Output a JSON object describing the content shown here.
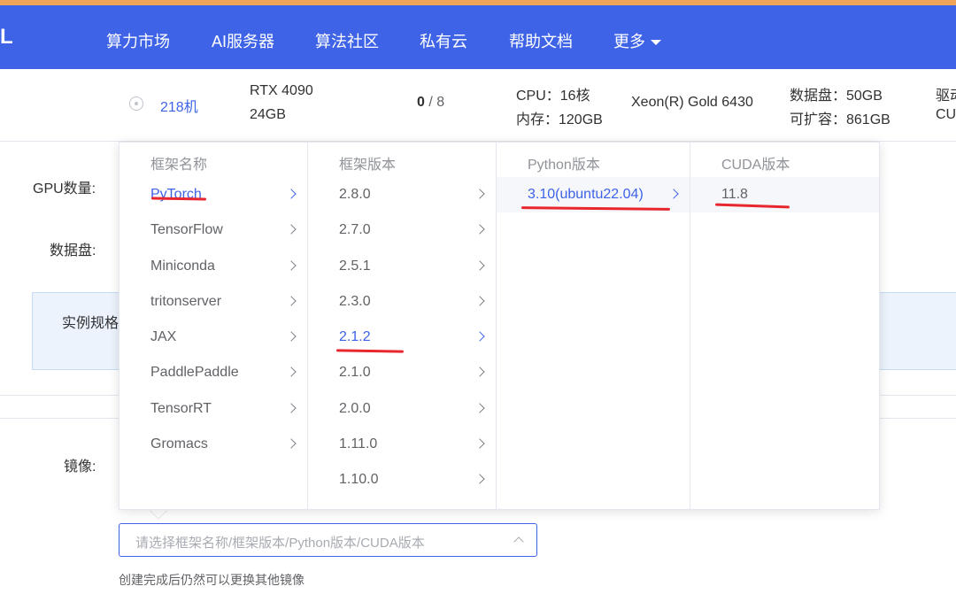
{
  "nav": {
    "logo": "L",
    "items": [
      "算力市场",
      "AI服务器",
      "算法社区",
      "私有云",
      "帮助文档",
      "更多"
    ]
  },
  "machine": {
    "name": "218机",
    "gpu_model": "RTX 4090",
    "gpu_mem": "24GB",
    "gpu_free": "0",
    "gpu_total": "/ 8",
    "cpu": "CPU：16核",
    "mem": "内存：120GB",
    "cpu_model": "Xeon(R) Gold 6430",
    "disk": "数据盘：50GB",
    "disk_expand": "可扩容：861GB",
    "driver_label": "驱动",
    "cuda_label": "CU"
  },
  "form": {
    "gpu_count_label": "GPU数量:",
    "data_disk_label": "数据盘:",
    "spec_label": "实例规格",
    "image_label": "镜像:"
  },
  "cascader": {
    "columns": [
      {
        "header": "框架名称",
        "options": [
          "PyTorch",
          "TensorFlow",
          "Miniconda",
          "tritonserver",
          "JAX",
          "PaddlePaddle",
          "TensorRT",
          "Gromacs"
        ],
        "active": 0
      },
      {
        "header": "框架版本",
        "options": [
          "2.8.0",
          "2.7.0",
          "2.5.1",
          "2.3.0",
          "2.1.2",
          "2.1.0",
          "2.0.0",
          "1.11.0",
          "1.10.0"
        ],
        "active": 4
      },
      {
        "header": "Python版本",
        "options": [
          "3.10(ubuntu22.04)"
        ],
        "active": 0
      },
      {
        "header": "CUDA版本",
        "options": [
          "11.8"
        ],
        "active": 0
      }
    ]
  },
  "select": {
    "placeholder": "请选择框架名称/框架版本/Python版本/CUDA版本"
  },
  "hint": "创建完成后仍然可以更换其他镜像",
  "colors": {
    "brand": "#3e63e6",
    "annotation": "#e8262e"
  }
}
